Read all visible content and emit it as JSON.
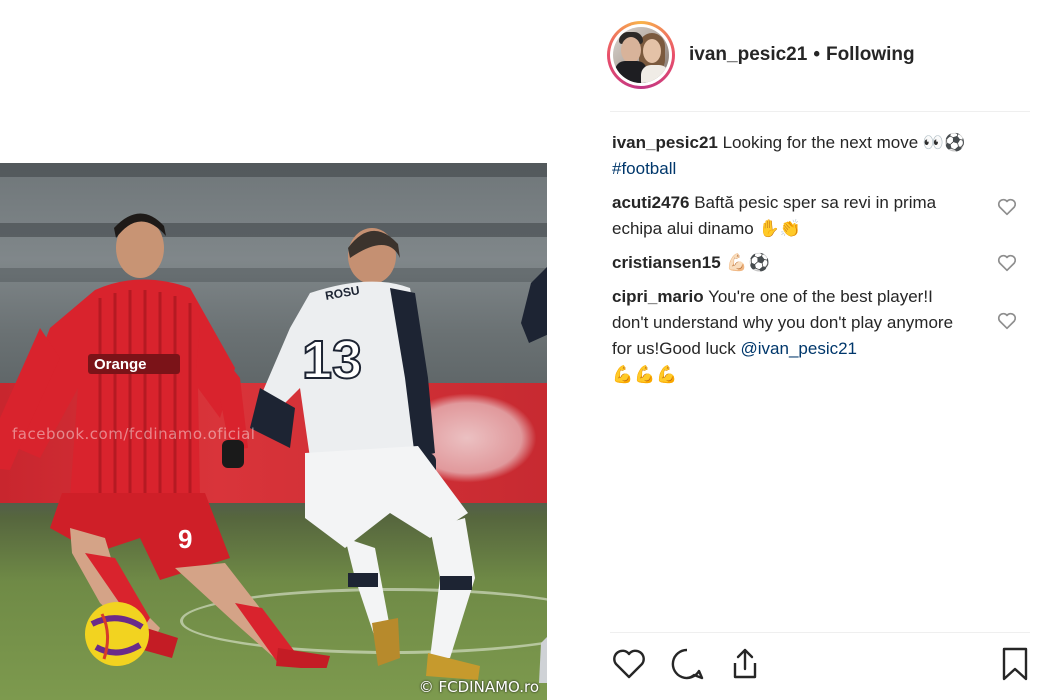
{
  "post": {
    "username": "ivan_pesic21",
    "separator": "•",
    "follow_status": "Following"
  },
  "photo": {
    "watermark_left": "facebook.com/fcdinamo.oficial",
    "watermark_right": "© FCDINAMO.ro",
    "player_left_number": "9",
    "player_left_sponsor": "Orange",
    "player_right_number": "13",
    "player_right_name": "ROSU"
  },
  "caption": {
    "user": "ivan_pesic21",
    "text": " Looking for the next move 👀⚽",
    "hashtag": "#football"
  },
  "comments": [
    {
      "user": "acuti2476",
      "text": " Baftă pesic sper sa revi in prima echipa alui dinamo ✋👏"
    },
    {
      "user": "cristiansen15",
      "text": " 💪🏻⚽"
    },
    {
      "user": "cipri_mario",
      "text": " You're one of the best player!I don't understand why you don't play anymore for us!Good luck ",
      "mention": "@ivan_pesic21",
      "extra": "💪💪💪"
    }
  ],
  "icons": {
    "like": "heart-icon",
    "comment": "comment-icon",
    "share": "share-icon",
    "save": "bookmark-icon"
  },
  "colors": {
    "link": "#00376b",
    "text": "#262626",
    "team_red": "#d9232d"
  }
}
